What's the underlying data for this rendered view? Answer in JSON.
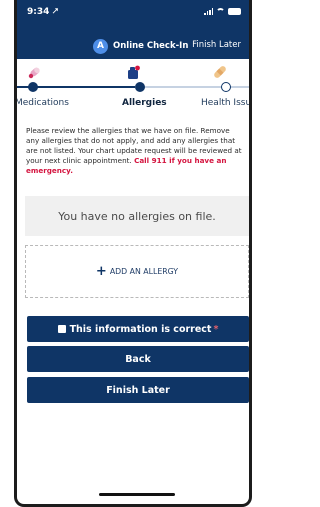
{
  "status_bar": {
    "time": "9:34 ⭧"
  },
  "header": {
    "badge_letter": "A",
    "title": "Online Check-In",
    "finish_later_link": "Finish Later"
  },
  "steps": [
    {
      "label": "Medications",
      "state": "done",
      "icon": "pill-icon"
    },
    {
      "label": "Allergies",
      "state": "current",
      "icon": "allergy-icon"
    },
    {
      "label": "Health Issues",
      "state": "upcoming",
      "icon": "bandage-icon"
    }
  ],
  "intro": {
    "text": "Please review the allergies that we have on file. Remove any allergies that do not apply, and add any allergies that are not listed. Your chart update request will be reviewed at your next clinic appointment. ",
    "emergency": "Call 911 if you have an emergency."
  },
  "no_allergies_text": "You have no allergies on file.",
  "add_allergy": {
    "plus": "+",
    "label": "ADD AN ALLERGY"
  },
  "buttons": {
    "confirm": "This information is correct",
    "required_mark": "*",
    "back": "Back",
    "finish_later": "Finish Later"
  },
  "colors": {
    "brand_navy": "#0f3566",
    "accent_blue": "#4e8ee8",
    "emergency_red": "#d4143f",
    "panel_gray": "#f0f0f0"
  }
}
